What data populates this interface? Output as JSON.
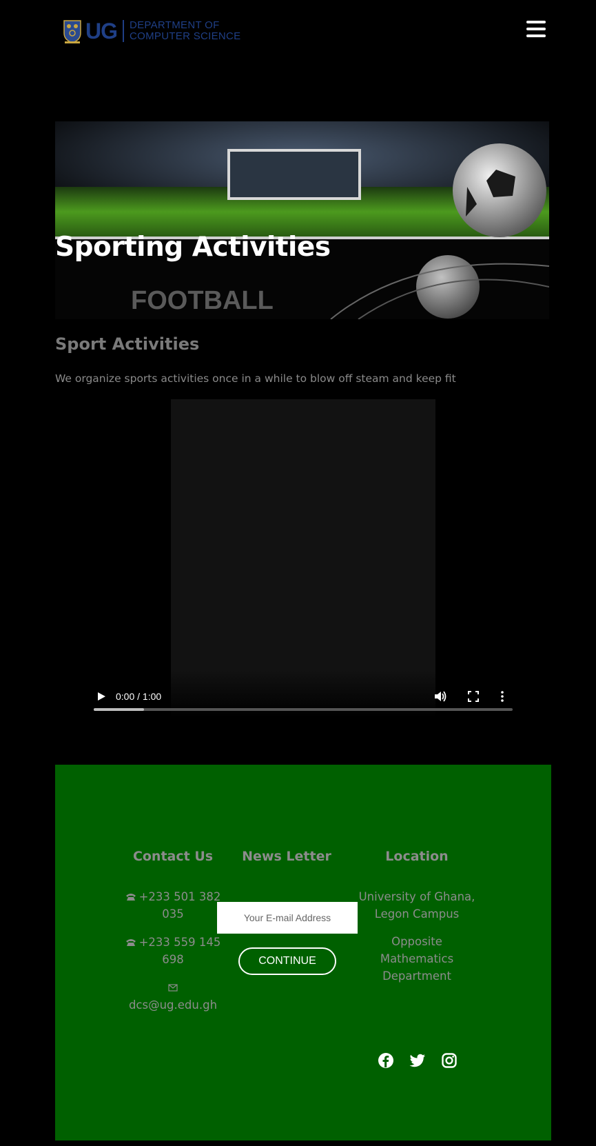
{
  "header": {
    "logo_abbr": "UG",
    "logo_dept_line1": "DEPARTMENT OF",
    "logo_dept_line2": "COMPUTER SCIENCE",
    "brand_color": "#1f3f86"
  },
  "hero": {
    "title": "Sporting Activities",
    "image_caption": "FOOTBALL"
  },
  "section": {
    "heading": "Sport Activities",
    "text": "We organize sports activities once in a while to blow off steam and keep fit"
  },
  "video": {
    "time": "0:00 / 1:00",
    "progress_fraction": 0.12
  },
  "footer": {
    "background": "#006000",
    "contact": {
      "title": "Contact Us",
      "phone1_a": "+233 501 382",
      "phone1_b": "035",
      "phone2_a": "+233 559 145",
      "phone2_b": "698",
      "email": "dcs@ug.edu.gh"
    },
    "newsletter": {
      "title": "News Letter",
      "placeholder": "Your E-mail Address",
      "button": "CONTINUE"
    },
    "location": {
      "title": "Location",
      "line1": "University of Ghana,",
      "line2": "Legon Campus",
      "line3": "Opposite",
      "line4": "Mathematics",
      "line5": "Department"
    },
    "social_icons": [
      "facebook-icon",
      "twitter-icon",
      "instagram-icon"
    ]
  }
}
